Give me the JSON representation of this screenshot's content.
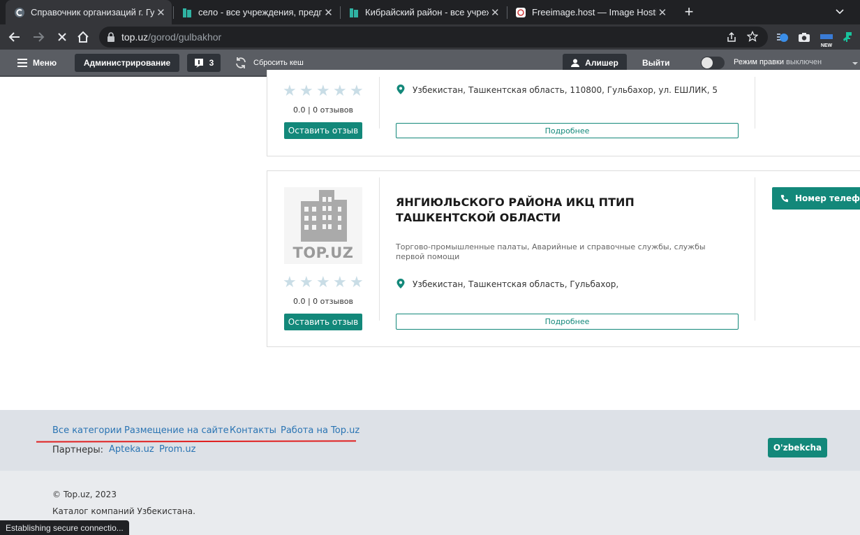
{
  "browser": {
    "tabs": [
      {
        "title": "Справочник организаций г. Гул",
        "active": true
      },
      {
        "title": "село - все учреждения, предпр",
        "active": false
      },
      {
        "title": "Кибрайский район - все учреж",
        "active": false
      },
      {
        "title": "Freeimage.host — Image Hosting",
        "active": false
      }
    ],
    "new_tab_symbol": "+",
    "url_host": "top.uz",
    "url_path": "/gorod/gulbakhor",
    "extension_badge": "NEW"
  },
  "admin_bar": {
    "menu_label": "Меню",
    "admin_label": "Администрирование",
    "notifications_count": "3",
    "reset_cache_label": "Сбросить кеш",
    "user_label": "Алишер",
    "logout_label": "Выйти",
    "edit_mode_label": "Режим правки",
    "edit_mode_state": "выключен"
  },
  "listings": [
    {
      "rating": "0.0",
      "reviews": "0 отзывов",
      "review_button": "Оставить отзыв",
      "address": "Узбекистан, Ташкентская область, 110800, Гульбахор, ул. ЕШЛИК, 5",
      "details_button": "Подробнее"
    },
    {
      "logo_text": "TOP.UZ",
      "title": "ЯНГИЮЛЬСКОГО РАЙОНА ИКЦ ПТИП ТАШКЕНТСКОЙ ОБЛАСТИ",
      "categories": "Торгово-промышленные палаты, Аварийные и справочные службы, службы первой помощи",
      "rating": "0.0",
      "reviews": "0 отзывов",
      "review_button": "Оставить отзыв",
      "address": "Узбекистан, Ташкентская область, Гульбахор,",
      "details_button": "Подробнее",
      "phone_button": "Номер телефона"
    }
  ],
  "footer": {
    "links": [
      "Все категории",
      "Размещение на сайте",
      "Контакты",
      "Работа на Top.uz"
    ],
    "partners_label": "Партнеры:",
    "partners": [
      "Apteka.uz",
      "Prom.uz"
    ],
    "language_button": "O'zbekcha",
    "copyright": "© Top.uz, 2023",
    "tagline": "Каталог компаний Узбекистана."
  },
  "status_bar": "Establishing secure connectio...",
  "colors": {
    "accent": "#13887a",
    "link": "#2a74b3",
    "annotation": "#e02020"
  }
}
